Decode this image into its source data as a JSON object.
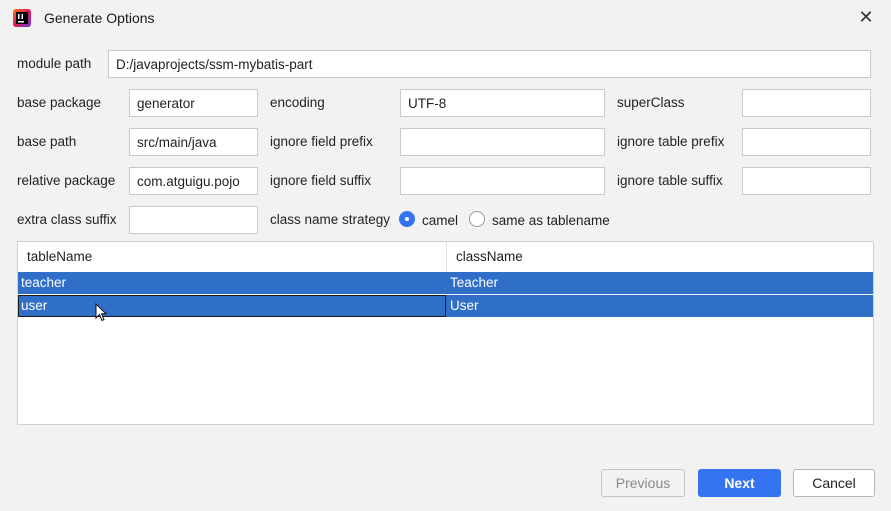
{
  "window": {
    "title": "Generate Options",
    "close_symbol": "✕",
    "icon": "intellij-app-icon"
  },
  "form": {
    "module_path_label": "module path",
    "module_path_value": "D:/javaprojects/ssm-mybatis-part",
    "base_package_label": "base package",
    "base_package_value": "generator",
    "base_path_label": "base path",
    "base_path_value": "src/main/java",
    "relative_package_label": "relative package",
    "relative_package_value": "com.atguigu.pojo",
    "extra_class_suffix_label": "extra class suffix",
    "extra_class_suffix_value": "",
    "encoding_label": "encoding",
    "encoding_value": "UTF-8",
    "ignore_field_prefix_label": "ignore field prefix",
    "ignore_field_prefix_value": "",
    "ignore_field_suffix_label": "ignore field suffix",
    "ignore_field_suffix_value": "",
    "class_name_strategy_label": "class name strategy",
    "strategy_options": [
      "camel",
      "same as tablename"
    ],
    "strategy_selected": "camel",
    "superclass_label": "superClass",
    "superclass_value": "",
    "ignore_table_prefix_label": "ignore table prefix",
    "ignore_table_prefix_value": "",
    "ignore_table_suffix_label": "ignore table suffix",
    "ignore_table_suffix_value": ""
  },
  "table": {
    "headers": [
      "tableName",
      "className"
    ],
    "rows": [
      {
        "tableName": "teacher",
        "className": "Teacher",
        "selected": true
      },
      {
        "tableName": "user",
        "className": "User",
        "selected": true
      }
    ]
  },
  "buttons": {
    "previous": "Previous",
    "next": "Next",
    "cancel": "Cancel"
  },
  "colors": {
    "accent": "#3574f0",
    "selection": "#2f6fc7",
    "background": "#f2f2f2"
  }
}
